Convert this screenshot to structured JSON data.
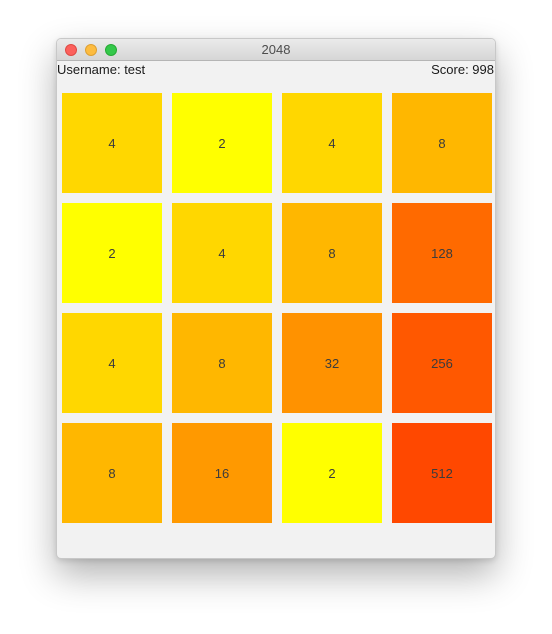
{
  "window": {
    "title": "2048"
  },
  "status": {
    "username": "Username: test",
    "score": "Score: 998"
  },
  "colors": {
    "2": "#ffff00",
    "4": "#ffd700",
    "8": "#ffb700",
    "16": "#ff9900",
    "32": "#ff9200",
    "128": "#ff6a00",
    "256": "#ff5800",
    "512": "#ff4800"
  },
  "board": {
    "rows": [
      [
        "4",
        "2",
        "4",
        "8"
      ],
      [
        "2",
        "4",
        "8",
        "128"
      ],
      [
        "4",
        "8",
        "32",
        "256"
      ],
      [
        "8",
        "16",
        "2",
        "512"
      ]
    ]
  }
}
